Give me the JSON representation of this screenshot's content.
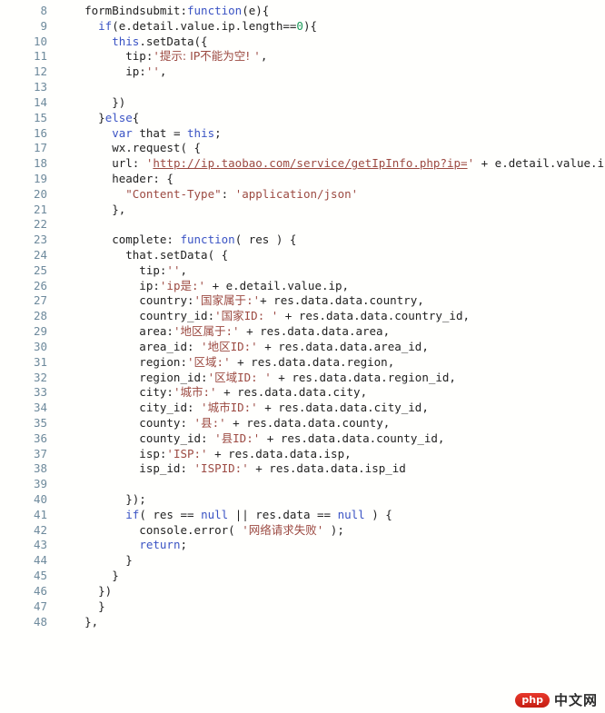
{
  "editor": {
    "language": "javascript",
    "background_color": "#fffffd",
    "gutter_color": "#6e8a9c",
    "keyword_color": "#3a53c4",
    "string_color": "#9c4a42",
    "number_color": "#1a9a5a",
    "text_color": "#222222",
    "first_line_number": 8,
    "last_line_number": 48
  },
  "watermark": {
    "badge_label": "php",
    "text_label": "中文网"
  },
  "lines": [
    {
      "num": "8",
      "tokens": [
        {
          "t": "plain",
          "v": "    formBindsubmit:"
        },
        {
          "t": "kw",
          "v": "function"
        },
        {
          "t": "plain",
          "v": "(e){"
        }
      ]
    },
    {
      "num": "9",
      "tokens": [
        {
          "t": "plain",
          "v": "      "
        },
        {
          "t": "kw",
          "v": "if"
        },
        {
          "t": "plain",
          "v": "(e.detail.value.ip.length=="
        },
        {
          "t": "num",
          "v": "0"
        },
        {
          "t": "plain",
          "v": "){"
        }
      ]
    },
    {
      "num": "10",
      "tokens": [
        {
          "t": "plain",
          "v": "        "
        },
        {
          "t": "kw",
          "v": "this"
        },
        {
          "t": "plain",
          "v": ".setData({"
        }
      ]
    },
    {
      "num": "11",
      "tokens": [
        {
          "t": "plain",
          "v": "          tip:"
        },
        {
          "t": "str",
          "v": "'"
        },
        {
          "t": "cjk",
          "v": "提示: IP不能为空! "
        },
        {
          "t": "str",
          "v": "'"
        },
        {
          "t": "plain",
          "v": ","
        }
      ]
    },
    {
      "num": "12",
      "tokens": [
        {
          "t": "plain",
          "v": "          ip:"
        },
        {
          "t": "str",
          "v": "''"
        },
        {
          "t": "plain",
          "v": ","
        }
      ]
    },
    {
      "num": "13",
      "tokens": [
        {
          "t": "plain",
          "v": ""
        }
      ]
    },
    {
      "num": "14",
      "tokens": [
        {
          "t": "plain",
          "v": "        })"
        }
      ]
    },
    {
      "num": "15",
      "tokens": [
        {
          "t": "plain",
          "v": "      }"
        },
        {
          "t": "kw",
          "v": "else"
        },
        {
          "t": "plain",
          "v": "{"
        }
      ]
    },
    {
      "num": "16",
      "tokens": [
        {
          "t": "plain",
          "v": "        "
        },
        {
          "t": "kw",
          "v": "var"
        },
        {
          "t": "plain",
          "v": " that = "
        },
        {
          "t": "kw",
          "v": "this"
        },
        {
          "t": "plain",
          "v": ";"
        }
      ]
    },
    {
      "num": "17",
      "tokens": [
        {
          "t": "plain",
          "v": "        wx.request( {"
        }
      ]
    },
    {
      "num": "18",
      "tokens": [
        {
          "t": "plain",
          "v": "        url: "
        },
        {
          "t": "str",
          "v": "'"
        },
        {
          "t": "url",
          "v": "http://ip.taobao.com/service/getIpInfo.php?ip="
        },
        {
          "t": "str",
          "v": "'"
        },
        {
          "t": "plain",
          "v": " + e.detail.value.ip,"
        }
      ]
    },
    {
      "num": "19",
      "tokens": [
        {
          "t": "plain",
          "v": "        header: {"
        }
      ]
    },
    {
      "num": "20",
      "tokens": [
        {
          "t": "plain",
          "v": "          "
        },
        {
          "t": "str",
          "v": "\"Content-Type\""
        },
        {
          "t": "plain",
          "v": ": "
        },
        {
          "t": "str",
          "v": "'application/json'"
        }
      ]
    },
    {
      "num": "21",
      "tokens": [
        {
          "t": "plain",
          "v": "        },"
        }
      ]
    },
    {
      "num": "22",
      "tokens": [
        {
          "t": "plain",
          "v": ""
        }
      ]
    },
    {
      "num": "23",
      "tokens": [
        {
          "t": "plain",
          "v": "        complete: "
        },
        {
          "t": "kw",
          "v": "function"
        },
        {
          "t": "plain",
          "v": "( res ) {"
        }
      ]
    },
    {
      "num": "24",
      "tokens": [
        {
          "t": "plain",
          "v": "          that.setData( {"
        }
      ]
    },
    {
      "num": "25",
      "tokens": [
        {
          "t": "plain",
          "v": "            tip:"
        },
        {
          "t": "str",
          "v": "''"
        },
        {
          "t": "plain",
          "v": ","
        }
      ]
    },
    {
      "num": "26",
      "tokens": [
        {
          "t": "plain",
          "v": "            ip:"
        },
        {
          "t": "str",
          "v": "'ip"
        },
        {
          "t": "cjk",
          "v": "是"
        },
        {
          "t": "str",
          "v": ":'"
        },
        {
          "t": "plain",
          "v": " + e.detail.value.ip,"
        }
      ]
    },
    {
      "num": "27",
      "tokens": [
        {
          "t": "plain",
          "v": "            country:"
        },
        {
          "t": "str",
          "v": "'"
        },
        {
          "t": "cjk",
          "v": "国家属于"
        },
        {
          "t": "str",
          "v": ":'"
        },
        {
          "t": "plain",
          "v": "+ res.data.data.country,"
        }
      ]
    },
    {
      "num": "28",
      "tokens": [
        {
          "t": "plain",
          "v": "            country_id:"
        },
        {
          "t": "str",
          "v": "'"
        },
        {
          "t": "cjk",
          "v": "国家"
        },
        {
          "t": "str",
          "v": "ID: '"
        },
        {
          "t": "plain",
          "v": " + res.data.data.country_id,"
        }
      ]
    },
    {
      "num": "29",
      "tokens": [
        {
          "t": "plain",
          "v": "            area:"
        },
        {
          "t": "str",
          "v": "'"
        },
        {
          "t": "cjk",
          "v": "地区属于"
        },
        {
          "t": "str",
          "v": ":'"
        },
        {
          "t": "plain",
          "v": " + res.data.data.area,"
        }
      ]
    },
    {
      "num": "30",
      "tokens": [
        {
          "t": "plain",
          "v": "            area_id: "
        },
        {
          "t": "str",
          "v": "'"
        },
        {
          "t": "cjk",
          "v": "地区"
        },
        {
          "t": "str",
          "v": "ID:'"
        },
        {
          "t": "plain",
          "v": " + res.data.data.area_id,"
        }
      ]
    },
    {
      "num": "31",
      "tokens": [
        {
          "t": "plain",
          "v": "            region:"
        },
        {
          "t": "str",
          "v": "'"
        },
        {
          "t": "cjk",
          "v": "区域"
        },
        {
          "t": "str",
          "v": ":'"
        },
        {
          "t": "plain",
          "v": " + res.data.data.region,"
        }
      ]
    },
    {
      "num": "32",
      "tokens": [
        {
          "t": "plain",
          "v": "            region_id:"
        },
        {
          "t": "str",
          "v": "'"
        },
        {
          "t": "cjk",
          "v": "区域"
        },
        {
          "t": "str",
          "v": "ID: '"
        },
        {
          "t": "plain",
          "v": " + res.data.data.region_id,"
        }
      ]
    },
    {
      "num": "33",
      "tokens": [
        {
          "t": "plain",
          "v": "            city:"
        },
        {
          "t": "str",
          "v": "'"
        },
        {
          "t": "cjk",
          "v": "城市"
        },
        {
          "t": "str",
          "v": ":'"
        },
        {
          "t": "plain",
          "v": " + res.data.data.city,"
        }
      ]
    },
    {
      "num": "34",
      "tokens": [
        {
          "t": "plain",
          "v": "            city_id: "
        },
        {
          "t": "str",
          "v": "'"
        },
        {
          "t": "cjk",
          "v": "城市"
        },
        {
          "t": "str",
          "v": "ID:'"
        },
        {
          "t": "plain",
          "v": " + res.data.data.city_id,"
        }
      ]
    },
    {
      "num": "35",
      "tokens": [
        {
          "t": "plain",
          "v": "            county: "
        },
        {
          "t": "str",
          "v": "'"
        },
        {
          "t": "cjk",
          "v": "县"
        },
        {
          "t": "str",
          "v": ":'"
        },
        {
          "t": "plain",
          "v": " + res.data.data.county,"
        }
      ]
    },
    {
      "num": "36",
      "tokens": [
        {
          "t": "plain",
          "v": "            county_id: "
        },
        {
          "t": "str",
          "v": "'"
        },
        {
          "t": "cjk",
          "v": "县"
        },
        {
          "t": "str",
          "v": "ID:'"
        },
        {
          "t": "plain",
          "v": " + res.data.data.county_id,"
        }
      ]
    },
    {
      "num": "37",
      "tokens": [
        {
          "t": "plain",
          "v": "            isp:"
        },
        {
          "t": "str",
          "v": "'ISP:'"
        },
        {
          "t": "plain",
          "v": " + res.data.data.isp,"
        }
      ]
    },
    {
      "num": "38",
      "tokens": [
        {
          "t": "plain",
          "v": "            isp_id: "
        },
        {
          "t": "str",
          "v": "'ISPID:'"
        },
        {
          "t": "plain",
          "v": " + res.data.data.isp_id"
        }
      ]
    },
    {
      "num": "39",
      "tokens": [
        {
          "t": "plain",
          "v": ""
        }
      ]
    },
    {
      "num": "40",
      "tokens": [
        {
          "t": "plain",
          "v": "          });"
        }
      ]
    },
    {
      "num": "41",
      "tokens": [
        {
          "t": "plain",
          "v": "          "
        },
        {
          "t": "kw",
          "v": "if"
        },
        {
          "t": "plain",
          "v": "( res == "
        },
        {
          "t": "kw",
          "v": "null"
        },
        {
          "t": "plain",
          "v": " || res.data == "
        },
        {
          "t": "kw",
          "v": "null"
        },
        {
          "t": "plain",
          "v": " ) {"
        }
      ]
    },
    {
      "num": "42",
      "tokens": [
        {
          "t": "plain",
          "v": "            console.error( "
        },
        {
          "t": "str",
          "v": "'"
        },
        {
          "t": "cjk",
          "v": "网络请求失败"
        },
        {
          "t": "str",
          "v": "'"
        },
        {
          "t": "plain",
          "v": " );"
        }
      ]
    },
    {
      "num": "43",
      "tokens": [
        {
          "t": "plain",
          "v": "            "
        },
        {
          "t": "kw",
          "v": "return"
        },
        {
          "t": "plain",
          "v": ";"
        }
      ]
    },
    {
      "num": "44",
      "tokens": [
        {
          "t": "plain",
          "v": "          }"
        }
      ]
    },
    {
      "num": "45",
      "tokens": [
        {
          "t": "plain",
          "v": "        }"
        }
      ]
    },
    {
      "num": "46",
      "tokens": [
        {
          "t": "plain",
          "v": "      })"
        }
      ]
    },
    {
      "num": "47",
      "tokens": [
        {
          "t": "plain",
          "v": "      }"
        }
      ]
    },
    {
      "num": "48",
      "tokens": [
        {
          "t": "plain",
          "v": "    },"
        }
      ]
    }
  ]
}
